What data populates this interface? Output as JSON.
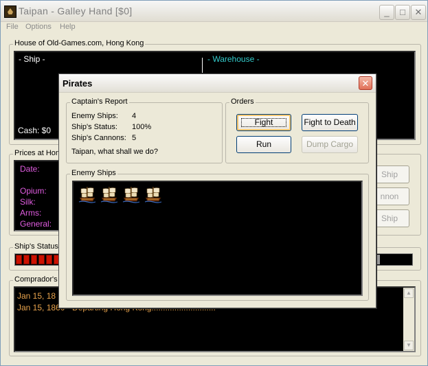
{
  "window": {
    "title": "Taipan - Galley Hand [$0]",
    "minimize_glyph": "_",
    "maximize_glyph": "□",
    "close_glyph": "✕"
  },
  "menu": {
    "items": [
      "File",
      "Options",
      "Help"
    ]
  },
  "firm": {
    "group_label": "House of Old-Games.com, Hong Kong",
    "ship_header": "- Ship -",
    "warehouse_header": "- Warehouse -",
    "cash": "Cash: $0"
  },
  "prices": {
    "group_label": "Prices at Hon",
    "date_label": "Date:",
    "commodities": [
      "Opium:",
      "Silk:",
      "Arms:",
      "General:"
    ]
  },
  "side_buttons": [
    "Ship",
    "nnon",
    "Ship"
  ],
  "ship_status": {
    "group_label": "Ship's Status",
    "hull_segments": 8
  },
  "comprador": {
    "group_label": "Comprador's R",
    "lines": [
      "Jan 15, 18",
      "Jan 15, 1860 - Departing Hong Kong............................"
    ]
  },
  "dialog": {
    "title": "Pirates",
    "close_glyph": "✕",
    "report": {
      "group_label": "Captain's Report",
      "rows": [
        {
          "label": "Enemy Ships:",
          "value": "4"
        },
        {
          "label": "Ship's Status:",
          "value": "100%"
        },
        {
          "label": "Ship's Cannons:",
          "value": "5"
        }
      ],
      "prompt": "Taipan, what shall we do?"
    },
    "orders": {
      "group_label": "Orders",
      "fight": "Fight",
      "fight_to_death": "Fight to Death",
      "run": "Run",
      "dump_cargo": "Dump Cargo"
    },
    "enemy": {
      "group_label": "Enemy Ships",
      "ship_count": 4,
      "ship_icon": "pirate-ship-icon"
    }
  },
  "colors": {
    "panel_bg": "#000000",
    "warehouse_text": "#33cccc",
    "price_text": "#e05ce0",
    "log_text": "#e8a34c",
    "hull_bar": "#cc1100"
  }
}
